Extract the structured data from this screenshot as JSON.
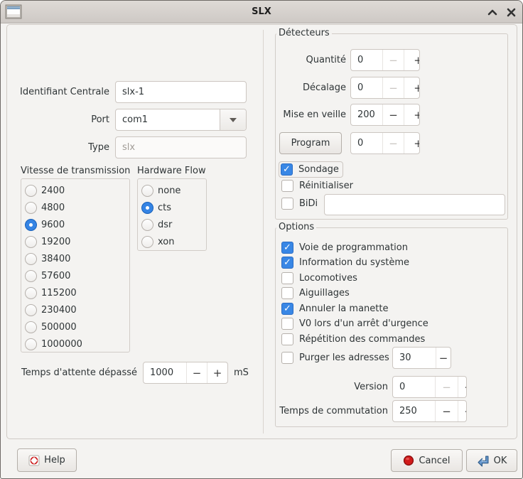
{
  "window": {
    "title": "SLX"
  },
  "glyphs": {
    "minus": "−",
    "plus": "+"
  },
  "left": {
    "id_label": "Identifiant Centrale",
    "id_value": "slx-1",
    "port_label": "Port",
    "port_value": "com1",
    "type_label": "Type",
    "type_value": "slx",
    "baud": {
      "title": "Vitesse de transmission",
      "options": [
        {
          "label": "2400",
          "selected": false
        },
        {
          "label": "4800",
          "selected": false
        },
        {
          "label": "9600",
          "selected": true
        },
        {
          "label": "19200",
          "selected": false
        },
        {
          "label": "38400",
          "selected": false
        },
        {
          "label": "57600",
          "selected": false
        },
        {
          "label": "115200",
          "selected": false
        },
        {
          "label": "230400",
          "selected": false
        },
        {
          "label": "500000",
          "selected": false
        },
        {
          "label": "1000000",
          "selected": false
        }
      ]
    },
    "flow": {
      "title": "Hardware Flow",
      "options": [
        {
          "label": "none",
          "selected": false
        },
        {
          "label": "cts",
          "selected": true
        },
        {
          "label": "dsr",
          "selected": false
        },
        {
          "label": "xon",
          "selected": false
        }
      ]
    },
    "timeout_label": "Temps d'attente dépassé",
    "timeout_value": "1000",
    "timeout_unit": "mS"
  },
  "detectors": {
    "title": "Détecteurs",
    "rows": [
      {
        "label": "Quantité",
        "value": "0"
      },
      {
        "label": "Décalage",
        "value": "0"
      },
      {
        "label": "Mise en veille",
        "value": "200"
      }
    ],
    "program_button": "Program",
    "program_value": "0",
    "checks": [
      {
        "label": "Sondage",
        "checked": true
      },
      {
        "label": "Réinitialiser",
        "checked": false
      },
      {
        "label": "BiDi",
        "checked": false
      }
    ],
    "bidi_value": ""
  },
  "options": {
    "title": "Options",
    "checks": [
      {
        "label": "Voie de programmation",
        "checked": true
      },
      {
        "label": "Information du système",
        "checked": true
      },
      {
        "label": "Locomotives",
        "checked": false
      },
      {
        "label": "Aiguillages",
        "checked": false
      },
      {
        "label": "Annuler la manette",
        "checked": true
      },
      {
        "label": "V0 lors d'un arrêt d'urgence",
        "checked": false
      },
      {
        "label": "Répétition des commandes",
        "checked": false
      }
    ],
    "purge_label": "Purger les adresses",
    "purge_value": "30",
    "version_label": "Version",
    "version_value": "0",
    "switch_label": "Temps de commutation",
    "switch_value": "250"
  },
  "footer": {
    "help": "Help",
    "cancel": "Cancel",
    "ok": "OK"
  }
}
